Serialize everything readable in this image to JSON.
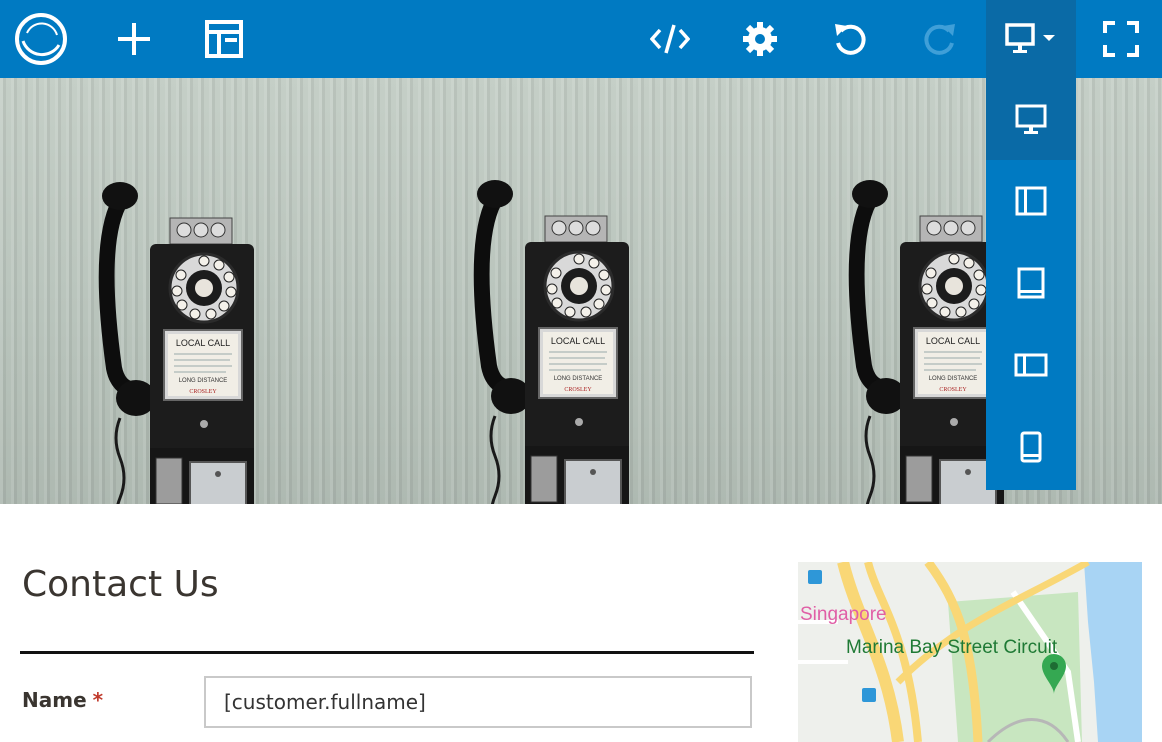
{
  "toolbar": {
    "buttons": [
      {
        "name": "logo",
        "icon": "circle-logo-icon"
      },
      {
        "name": "add",
        "icon": "plus-icon"
      },
      {
        "name": "layout",
        "icon": "layout-icon"
      },
      {
        "name": "code",
        "icon": "code-icon"
      },
      {
        "name": "settings",
        "icon": "gear-icon"
      },
      {
        "name": "undo",
        "icon": "undo-icon"
      },
      {
        "name": "redo",
        "icon": "redo-icon",
        "disabled": true
      },
      {
        "name": "device",
        "icon": "monitor-icon",
        "active": true
      },
      {
        "name": "fullscreen",
        "icon": "fullscreen-icon"
      }
    ],
    "colors": {
      "background": "#007ac2",
      "active": "#0a6aa6",
      "icon": "#ffffff",
      "disabled_icon": "#3f9fd8"
    }
  },
  "device_menu": {
    "items": [
      {
        "name": "desktop",
        "icon": "monitor-icon",
        "selected": true
      },
      {
        "name": "laptop-sidebar",
        "icon": "sidebar-panel-icon"
      },
      {
        "name": "tablet-portrait",
        "icon": "tablet-icon"
      },
      {
        "name": "tablet-landscape",
        "icon": "sidebar-panel-icon"
      },
      {
        "name": "mobile",
        "icon": "phone-icon"
      }
    ]
  },
  "hero": {
    "phones": [
      {
        "sign": "LOCAL CALL",
        "brand": "CROSLEY",
        "label": "LONG DISTANCE"
      },
      {
        "sign": "LOCAL CALL",
        "brand": "CROSLEY",
        "label": "LONG DISTANCE"
      },
      {
        "sign": "LOCAL CALL",
        "brand": "CROSLEY",
        "label": "LONG DISTANCE"
      }
    ]
  },
  "contact": {
    "title": "Contact Us",
    "name_label": "Name",
    "required_mark": "*",
    "name_value": "[customer.fullname]"
  },
  "map": {
    "label_city": "Singapore",
    "label_place": "Marina Bay Street Circuit"
  }
}
